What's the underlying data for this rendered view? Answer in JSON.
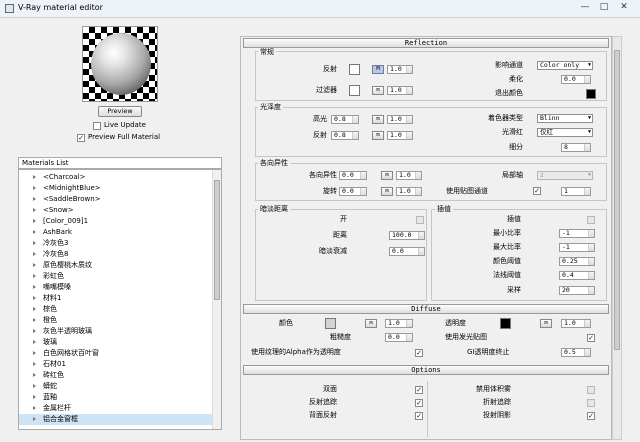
{
  "window": {
    "title": "V-Ray material editor",
    "controls": [
      "—",
      "□",
      "✕"
    ]
  },
  "preview": {
    "button_label": "Preview",
    "live_update_label": "Live Update",
    "live_update_checked": false,
    "full_material_label": "Preview Full Material",
    "full_material_checked": true
  },
  "materials": {
    "header": "Materials List",
    "items": [
      "<Charcoal>",
      "<MidnightBlue>",
      "<SaddleBrown>",
      "<Snow>",
      "[Color_009]1",
      "AshBark",
      "冷灰色3",
      "冷灰色8",
      "原色樱桃木质纹",
      "彩虹色",
      "嘴嘴模嗓",
      "材料1",
      "棕色",
      "橙色",
      "灰色半透明玻璃",
      "玻璃",
      "白色网格状百叶窗",
      "石材01",
      "砖红色",
      "蟒蛇",
      "蓝釉",
      "金属栏杆",
      "铝合金窗框"
    ],
    "selected_index": 22
  },
  "reflection": {
    "header": "Reflection",
    "basic": {
      "title": "常规",
      "reflect_label": "反射",
      "reflect_color": "#ffffff",
      "reflect_m": "M",
      "reflect_value": "1.0",
      "filter_label": "过滤器",
      "filter_color": "#ffffff",
      "filter_m": "m",
      "filter_value": "1.0",
      "affect_channels_label": "影响通道",
      "affect_channels_value": "Color only",
      "soften_label": "柔化",
      "soften_value": "0.0",
      "exit_color_label": "退出颜色",
      "exit_color": "#000000"
    },
    "gloss": {
      "title": "光泽度",
      "hilight_label": "高光",
      "hilight_value": "0.8",
      "hilight_m": "m",
      "hilight_mult": "1.0",
      "refl_label": "反射",
      "refl_value": "0.8",
      "refl_m": "m",
      "refl_mult": "1.0",
      "brdf_label": "着色器类型",
      "brdf_value": "Blinn",
      "anisotropy_label": "光滑红",
      "anisotropy_value": "仅红",
      "subdivs_label": "细分",
      "subdivs_value": "8"
    },
    "aniso": {
      "title": "各向异性",
      "aniso_label": "各向异性",
      "aniso_value": "0.0",
      "aniso_m": "m",
      "aniso_mult": "1.0",
      "rotation_label": "旋转",
      "rotation_value": "0.0",
      "rotation_m": "m",
      "rotation_mult": "1.0",
      "local_axis_label": "局部轴",
      "local_axis_value": "z",
      "map_channel_label": "使用贴图通道",
      "map_channel_value": "1"
    },
    "dim": {
      "title": "暗淡距离",
      "on_label": "开",
      "distance_label": "距离",
      "distance_value": "100.0",
      "falloff_label": "暗淡衰减",
      "falloff_value": "0.0"
    },
    "interp": {
      "title": "插值",
      "interp_label": "插值",
      "min_rate_label": "最小比率",
      "min_rate_value": "-1",
      "max_rate_label": "最大比率",
      "max_rate_value": "-1",
      "color_thresh_label": "颜色阈值",
      "color_thresh_value": "0.25",
      "normal_thresh_label": "法线阈值",
      "normal_thresh_value": "0.4",
      "samples_label": "采样",
      "samples_value": "20"
    }
  },
  "diffuse": {
    "header": "Diffuse",
    "color_label": "颜色",
    "color": "#d4d4d4",
    "color_m": "m",
    "color_value": "1.0",
    "transparency_label": "透明度",
    "transparency_color": "#000000",
    "transparency_m": "m",
    "transparency_value": "1.0",
    "roughness_label": "粗糙度",
    "roughness_value": "0.0",
    "use_irradiance_label": "使用发光贴图",
    "use_alpha_label": "使用纹理的Alpha作为透明度",
    "gi_cutoff_label": "GI透明度终止",
    "gi_cutoff_value": "0.5"
  },
  "options": {
    "header": "Options",
    "double_sided_label": "双面",
    "double_sided_checked": true,
    "reflect_trace_label": "反射追踪",
    "reflect_trace_checked": true,
    "back_reflect_label": "背面反射",
    "back_reflect_checked": true,
    "disable_fog_label": "禁用体积雾",
    "disable_fog_checked": false,
    "refract_trace_label": "折射追踪",
    "refract_trace_checked": false,
    "cast_shadow_label": "投射阴影",
    "cast_shadow_checked": true
  }
}
